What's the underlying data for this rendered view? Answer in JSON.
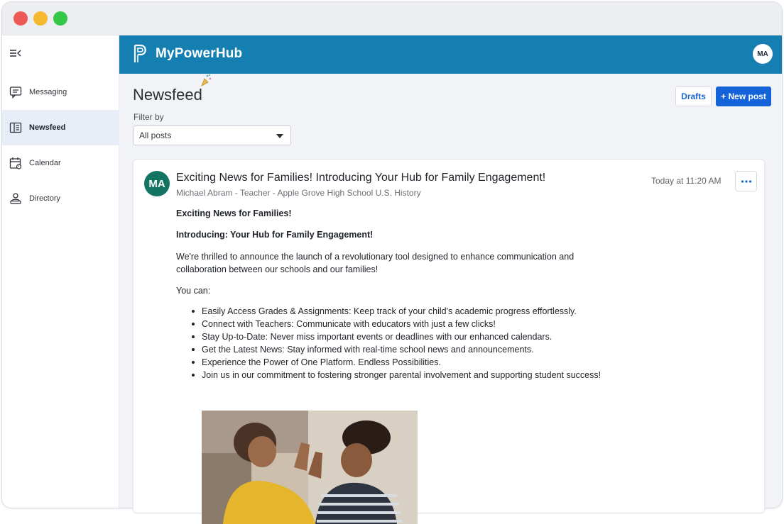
{
  "app": {
    "brand": "MyPowerHub",
    "user_initials": "MA"
  },
  "sidebar": {
    "items": [
      {
        "label": "Messaging",
        "icon": "messaging-icon"
      },
      {
        "label": "Newsfeed",
        "icon": "newsfeed-icon",
        "active": true
      },
      {
        "label": "Calendar",
        "icon": "calendar-icon"
      },
      {
        "label": "Directory",
        "icon": "directory-icon"
      }
    ]
  },
  "main": {
    "title": "Newsfeed",
    "filter_label": "Filter by",
    "filter_value": "All posts",
    "drafts_label": "Drafts",
    "new_post_label": "+ New post"
  },
  "post": {
    "avatar_initials": "MA",
    "title": "Exciting News for Families! Introducing Your Hub for Family Engagement!",
    "author": "Michael Abram - Teacher - Apple Grove High School U.S. History",
    "time": "Today at 11:20 AM",
    "heading1": "Exciting News for Families!",
    "heading2": "Introducing: Your Hub for Family Engagement!",
    "paragraph": "We're thrilled to announce the launch of a revolutionary tool designed to enhance communication and collaboration between our schools and our families!",
    "you_can": "You can:",
    "bullets": [
      "Easily Access Grades & Assignments: Keep track of your child's academic progress effortlessly.",
      "Connect with Teachers: Communicate with educators with just a few clicks!",
      "Stay Up-to-Date: Never miss important events or deadlines with our enhanced calendars.",
      "Get the Latest News: Stay informed with real-time school news and announcements.",
      "Experience the Power of One Platform. Endless Possibilities.",
      "Join us in our commitment to fostering stronger parental involvement and supporting student success!"
    ]
  },
  "colors": {
    "header": "#147fb0",
    "primary_button": "#1463d8",
    "avatar_green": "#137561",
    "sidebar_active": "#e7eef8"
  }
}
